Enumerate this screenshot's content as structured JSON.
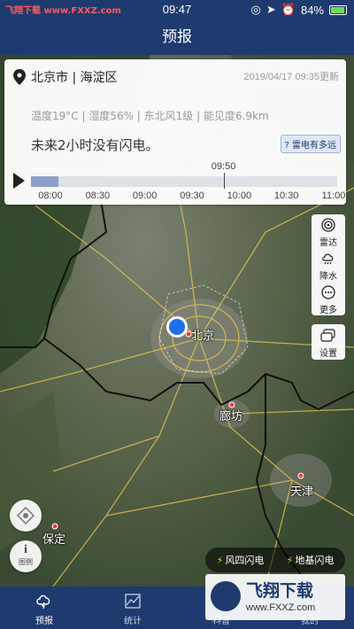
{
  "statusbar": {
    "site_left": "飞翔下载",
    "site_url": "www.FXXZ.com",
    "time": "09:47",
    "battery": "84%",
    "battery_level": 84
  },
  "header": {
    "title": "预报"
  },
  "card": {
    "location": "北京市 | 海淀区",
    "updated": "2019/04/17 09:35更新",
    "weather": "温度19°C | 湿度56% | 东北风1级 | 能见度6.9km",
    "message": "未来2小时没有闪电。",
    "howfar_button": "? 雷电有多远",
    "timeline": {
      "current_label": "09:50",
      "progress": 0.09,
      "ticks": [
        "08:00",
        "08:30",
        "09:00",
        "09:30",
        "10:00",
        "10:30",
        "11:00"
      ]
    }
  },
  "tools": {
    "radar": "雷达",
    "rain": "降水",
    "more": "更多",
    "settings": "设置"
  },
  "left_buttons": {
    "legend_label": "图例"
  },
  "map_labels": {
    "beijing": "北京",
    "langfang": "廊坊",
    "tianjin": "天津",
    "baoding": "保定"
  },
  "legend": {
    "item1": "风四闪电",
    "item2": "地基闪电"
  },
  "tabs": [
    {
      "label": "预报",
      "active": true
    },
    {
      "label": "统计",
      "active": false
    },
    {
      "label": "科普",
      "active": false
    },
    {
      "label": "我的",
      "active": false
    }
  ],
  "watermark": {
    "brand": "飞翔下载",
    "url": "www.FXXZ.com"
  },
  "colors": {
    "primary": "#1f3a6e",
    "lightning": "#f5c518",
    "boundary": "#111111",
    "roads": "#e8c84a"
  }
}
